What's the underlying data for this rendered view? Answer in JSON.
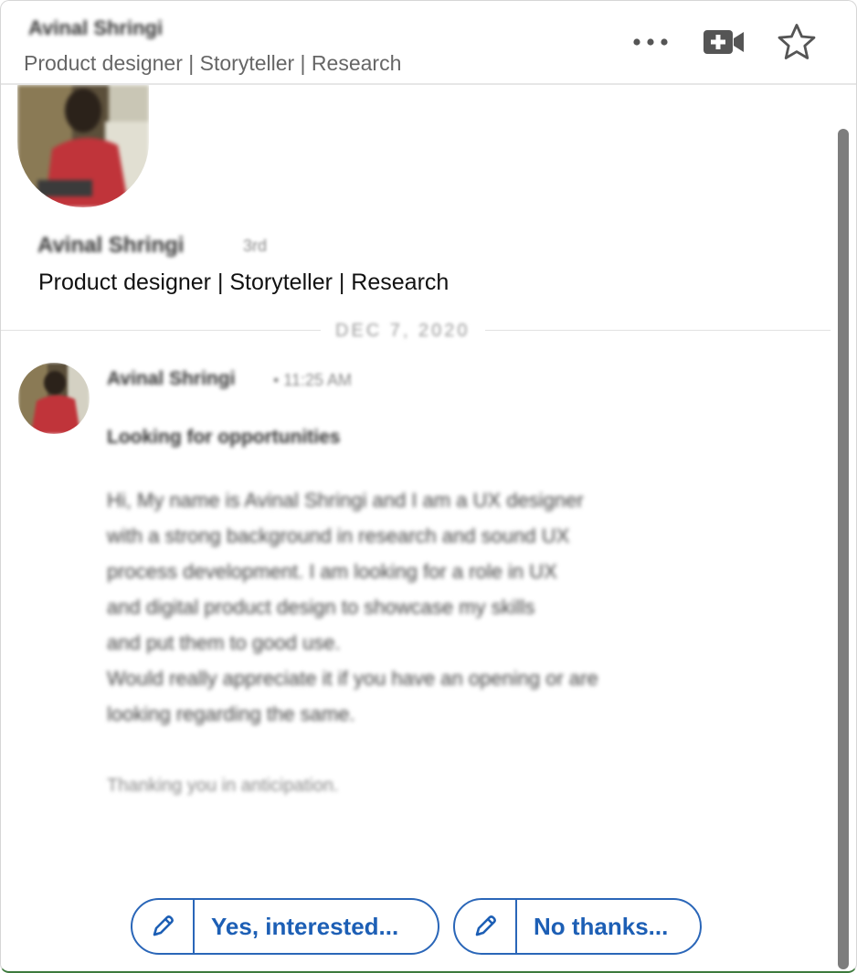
{
  "header": {
    "name": "Avinal Shringi",
    "subtitle": "Product designer | Storyteller | Research",
    "icons": [
      "more-icon",
      "video-add-icon",
      "star-icon"
    ]
  },
  "profile": {
    "name": "Avinal Shringi",
    "degree": "3rd",
    "headline": "Product designer | Storyteller | Research"
  },
  "date_separator": "DEC 7, 2020",
  "message": {
    "sender": "Avinal Shringi",
    "time": "• 11:25 AM",
    "subject": "Looking for opportunities",
    "body_lines": [
      "Hi, My name is Avinal Shringi and I am a UX designer",
      "with a strong background in research and sound UX",
      "process development. I am looking for a role in UX",
      "and digital product design to showcase my skills",
      "and put them to good use.",
      "Would really appreciate it if you have an opening or are",
      "looking regarding the same."
    ],
    "signature": "Thanking you in anticipation."
  },
  "replies": {
    "yes_label": "Yes, interested...",
    "no_label": "No thanks..."
  },
  "colors": {
    "accent": "#2a66b8",
    "avatar_shirt": "#c0343a",
    "scrollbar": "#7d7d7d"
  }
}
